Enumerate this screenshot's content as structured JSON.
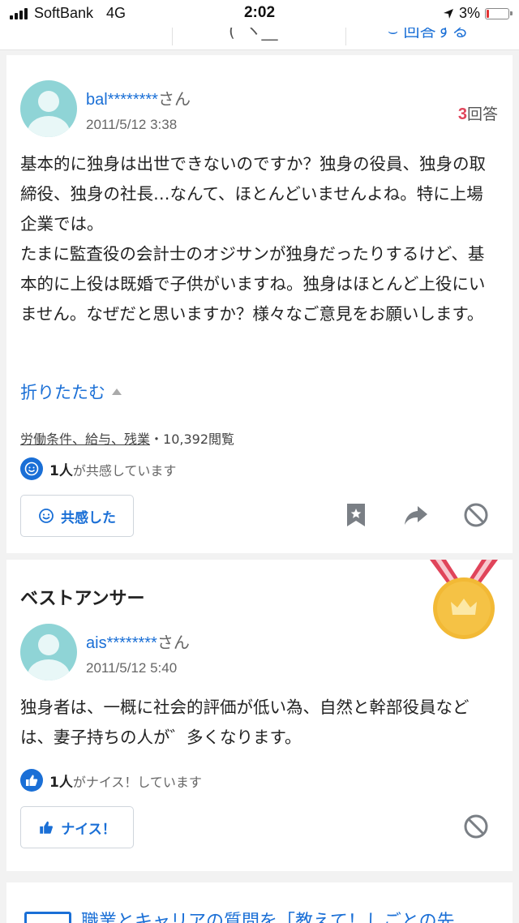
{
  "status_bar": {
    "carrier": "SoftBank",
    "network": "4G",
    "time": "2:02",
    "battery": "3%",
    "battery_level": 0.03,
    "battery_color": "#e33333"
  },
  "question": {
    "user_id": "bal********",
    "user_suffix": "さん",
    "date": "2011/5/12 3:38",
    "answer_count": "3",
    "answer_label": "回答",
    "body": "基本的に独身は出世できないのですか？独身の役員、独身の取締役、独身の社長…なんて、ほとんどいませんよね。特に上場企業では。\nたまに監査役の会計士のオジサンが独身だったりするけど、基本的に上役は既婚で子供がいますね。独身はほとんど上役にいません。なぜだと思いますか？様々なご意見をお願いします。",
    "collapse_label": "折りたたむ",
    "tags": [
      "労働条件、給与、残業"
    ],
    "views": "10,392閲覧",
    "empathy_count": "1人",
    "empathy_text": "が共感しています",
    "empathy_button": "共感した"
  },
  "best_answer": {
    "title": "ベストアンサー",
    "user_id": "ais********",
    "user_suffix": "さん",
    "date": "2011/5/12 5:40",
    "body": "独身者は、一概に社会的評価が低い為、自然と幹部役員などは、妻子持ちの人が゛多くなります。",
    "nice_count": "1人",
    "nice_text": "がナイス！しています",
    "nice_button": "ナイス！"
  },
  "teaser": {
    "text": "職業とキャリアの質問を「教えて！しごとの先"
  },
  "colors": {
    "accent": "#1a6fd6",
    "answer_count": "#e0445a",
    "avatar": "#8fd4d6",
    "medal_gold": "#f2b935",
    "ribbon": "#e0445a"
  }
}
